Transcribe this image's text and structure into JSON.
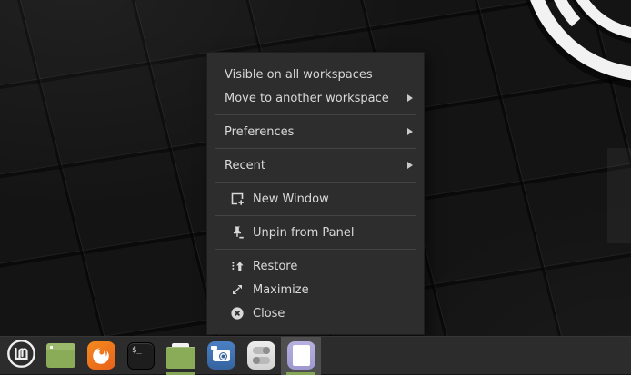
{
  "colors": {
    "wallpaper_bg": "#141414",
    "menu_bg": "#2d2d2d",
    "menu_text": "#d9d9d9",
    "menu_separator": "#434343",
    "panel_bg": "#2c2c2c",
    "active_cell_bg": "#4f4f4f",
    "accent_green": "#85a556",
    "folder_green": "#8aab57",
    "firefox_orange": "#e8611a",
    "camera_blue": "#35649f",
    "editor_lavender": "#a9a4d8"
  },
  "context_menu": {
    "items": [
      {
        "label": "Visible on all workspaces",
        "icon": null,
        "has_submenu": false
      },
      {
        "label": "Move to another workspace",
        "icon": null,
        "has_submenu": true
      },
      {
        "label": "Preferences",
        "icon": null,
        "has_submenu": true
      },
      {
        "label": "Recent",
        "icon": null,
        "has_submenu": true
      },
      {
        "label": "New Window",
        "icon": "new-window-icon",
        "has_submenu": false
      },
      {
        "label": "Unpin from Panel",
        "icon": "unpin-icon",
        "has_submenu": false
      },
      {
        "label": "Restore",
        "icon": "restore-icon",
        "has_submenu": false
      },
      {
        "label": "Maximize",
        "icon": "maximize-icon",
        "has_submenu": false
      },
      {
        "label": "Close",
        "icon": "close-icon",
        "has_submenu": false
      }
    ]
  },
  "taskbar": {
    "terminal_glyph": "$_",
    "items": [
      {
        "icon": "mint-menu-icon",
        "running": false,
        "active": false
      },
      {
        "icon": "window-app-icon",
        "running": false,
        "active": false
      },
      {
        "icon": "firefox-icon",
        "running": false,
        "active": false
      },
      {
        "icon": "terminal-icon",
        "running": false,
        "active": false
      },
      {
        "icon": "file-manager-icon",
        "running": true,
        "active": false
      },
      {
        "icon": "screenshot-icon",
        "running": false,
        "active": false
      },
      {
        "icon": "settings-icon",
        "running": false,
        "active": false
      },
      {
        "icon": "text-editor-icon",
        "running": true,
        "active": true
      }
    ]
  }
}
